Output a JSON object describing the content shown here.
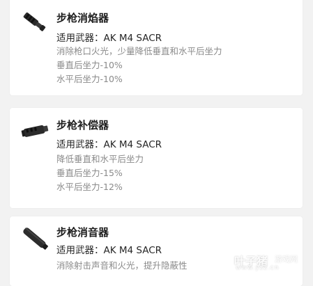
{
  "items": [
    {
      "icon": "flash-hider-icon",
      "title": "步枪消焰器",
      "weapons": "适用武器：AK M4 SACR",
      "desc": [
        "消除枪口火光，少量降低垂直和水平后坐力",
        "垂直后坐力-10%",
        "水平后坐力-10%"
      ]
    },
    {
      "icon": "compensator-icon",
      "title": "步枪补偿器",
      "weapons": "适用武器：AK M4 SACR",
      "desc": [
        "降低垂直和水平后坐力",
        "垂直后坐力-15%",
        "水平后坐力-12%"
      ]
    },
    {
      "icon": "suppressor-icon",
      "title": "步枪消音器",
      "weapons": "适用武器：AK M4 SACR",
      "desc": [
        "消除射击声音和火光，提升隐蔽性"
      ]
    }
  ],
  "watermark": {
    "brand": "叶子猪",
    "tag": "游戏网",
    "url": "www.yzz.cn"
  },
  "colors": {
    "background": "#f2f2f2",
    "card": "#ffffff",
    "title": "#1e1e1e",
    "description": "#8a8a8a"
  }
}
